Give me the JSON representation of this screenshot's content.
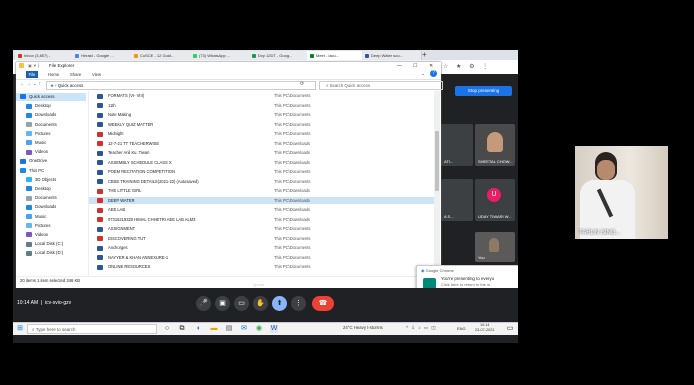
{
  "browser": {
    "tabs": [
      {
        "label": "Inbox (3,857) -",
        "icon_color": "#d93025"
      },
      {
        "label": "Herald - Google ...",
        "icon_color": "#4285f4"
      },
      {
        "label": "CoSCE - 12 Guid...",
        "icon_color": "#f29900"
      },
      {
        "label": "(73) WhatsApp ...",
        "icon_color": "#25d366"
      },
      {
        "label": "Dxy 12DT - Goog...",
        "icon_color": "#0f9d58"
      },
      {
        "label": "Meet - iacu...",
        "icon_color": "#00832d"
      },
      {
        "label": "Deep Water sou...",
        "icon_color": "#2b579a"
      }
    ],
    "new_tab_symbol": "+"
  },
  "explorer": {
    "title": "File Explorer",
    "window_controls": {
      "minimize": "—",
      "maximize": "☐",
      "close": "✕"
    },
    "ribbon_tabs": [
      "File",
      "Home",
      "Share",
      "View"
    ],
    "address": "Quick access",
    "search_placeholder": "Search Quick access",
    "nav_items": [
      {
        "label": "Quick access",
        "color": "#1a73e8",
        "selected": true
      },
      {
        "label": "Desktop",
        "color": "#1e88e5"
      },
      {
        "label": "Downloads",
        "color": "#1e88e5"
      },
      {
        "label": "Documents",
        "color": "#90a4ae"
      },
      {
        "label": "Pictures",
        "color": "#64b5f6"
      },
      {
        "label": "Music",
        "color": "#42a5f5"
      },
      {
        "label": "Videos",
        "color": "#7e57c2"
      },
      {
        "label": "OneDrive",
        "color": "#1976d2"
      },
      {
        "label": "This PC",
        "color": "#1e88e5"
      },
      {
        "label": "3D Objects",
        "color": "#29b6f6"
      },
      {
        "label": "Desktop",
        "color": "#1e88e5"
      },
      {
        "label": "Documents",
        "color": "#90a4ae"
      },
      {
        "label": "Downloads",
        "color": "#1e88e5"
      },
      {
        "label": "Music",
        "color": "#42a5f5"
      },
      {
        "label": "Pictures",
        "color": "#64b5f6"
      },
      {
        "label": "Videos",
        "color": "#7e57c2"
      },
      {
        "label": "Local Disk (C:)",
        "color": "#607d8b"
      },
      {
        "label": "Local Disk (D:)",
        "color": "#607d8b"
      }
    ],
    "files": [
      {
        "name": "FORMATS (VI- VIII)",
        "location": "This PC\\Documents",
        "type": "word"
      },
      {
        "name": "11th",
        "location": "This PC\\Documents",
        "type": "word"
      },
      {
        "name": "Note Making",
        "location": "This PC\\Documents",
        "type": "word"
      },
      {
        "name": "WEEKLY QUIZ MATTER",
        "location": "This PC\\Documents",
        "type": "word"
      },
      {
        "name": "Midnight",
        "location": "This PC\\Documents",
        "type": "pdf"
      },
      {
        "name": "12-7-21 TT TEACHERWISE",
        "location": "This PC\\Downloads",
        "type": "pdf"
      },
      {
        "name": "Teacher Anil Ku. Tiwari",
        "location": "This PC\\Downloads",
        "type": "word"
      },
      {
        "name": "ASSEMBLY SCHEDULE CLASS X",
        "location": "This PC\\Downloads",
        "type": "word"
      },
      {
        "name": "POEM RECITATION COMPETITION",
        "location": "This PC\\Documents",
        "type": "word"
      },
      {
        "name": "CBSE TRAINING DETAILS(2021-22) (Autosaved)",
        "location": "This PC\\Documents",
        "type": "word"
      },
      {
        "name": "THE LITTLE GIRL",
        "location": "This PC\\Downloads",
        "type": "pdf"
      },
      {
        "name": "DEEP WATER",
        "location": "This PC\\Downloads",
        "type": "pdf",
        "selected": true
      },
      {
        "name": "AEE LAB",
        "location": "This PC\\Downloads",
        "type": "pdf"
      },
      {
        "name": "07316219320 HIMAL CHHETRI AEE LAB ALM3",
        "location": "This PC\\Downloads",
        "type": "pdf"
      },
      {
        "name": "ASSIGNMENT",
        "location": "This PC\\Documents",
        "type": "word"
      },
      {
        "name": "DISCOVERING TUT",
        "location": "This PC\\Documents",
        "type": "pdf"
      },
      {
        "name": "Anchorges",
        "location": "This PC\\Documents",
        "type": "word"
      },
      {
        "name": "NAYYER & KHAN ANNEXURE-1",
        "location": "This PC\\Documents",
        "type": "word"
      },
      {
        "name": "ONLINE RESOURCES",
        "location": "This PC\\Documents",
        "type": "word"
      }
    ],
    "status": "20 items    1 item selected  346 KB",
    "file_colors": {
      "word": "#2b579a",
      "pdf": "#d32f2f"
    }
  },
  "meet": {
    "stop_presenting": "Stop presenting",
    "participants": [
      {
        "name": "SHEETAL CHOW...",
        "kind": "video"
      },
      {
        "name": "UDAY TIWARI W...",
        "kind": "avatar",
        "initial": "U",
        "avatar_color": "#e91e63"
      },
      {
        "name": "You",
        "kind": "video"
      }
    ],
    "partial_tiles": [
      "ATI...",
      "A S..."
    ],
    "meeting_time": "10:14 AM",
    "meeting_code": "icv-svio-gzv",
    "ignore_label": "Ignore",
    "controls": [
      {
        "name": "mic",
        "symbol": "🎤"
      },
      {
        "name": "camera",
        "symbol": "▣"
      },
      {
        "name": "captions",
        "symbol": "▭"
      },
      {
        "name": "raise-hand",
        "symbol": "✋"
      },
      {
        "name": "present",
        "symbol": "⬆"
      },
      {
        "name": "more",
        "symbol": "⋮"
      },
      {
        "name": "end-call",
        "symbol": "☎"
      }
    ],
    "presenter_name": "TARUN SING..."
  },
  "notification": {
    "app": "Google Chrome",
    "title": "You're presenting to everyo",
    "body_1": "Click here to return to the m",
    "body_2": "when you're ready to stop p",
    "source": "meet.google.com"
  },
  "taskbar": {
    "search_placeholder": "Type here to search",
    "weather": "24°C  Heavy t-storms",
    "language": "ENG",
    "time": "10:14",
    "date": "23-07-2021"
  }
}
